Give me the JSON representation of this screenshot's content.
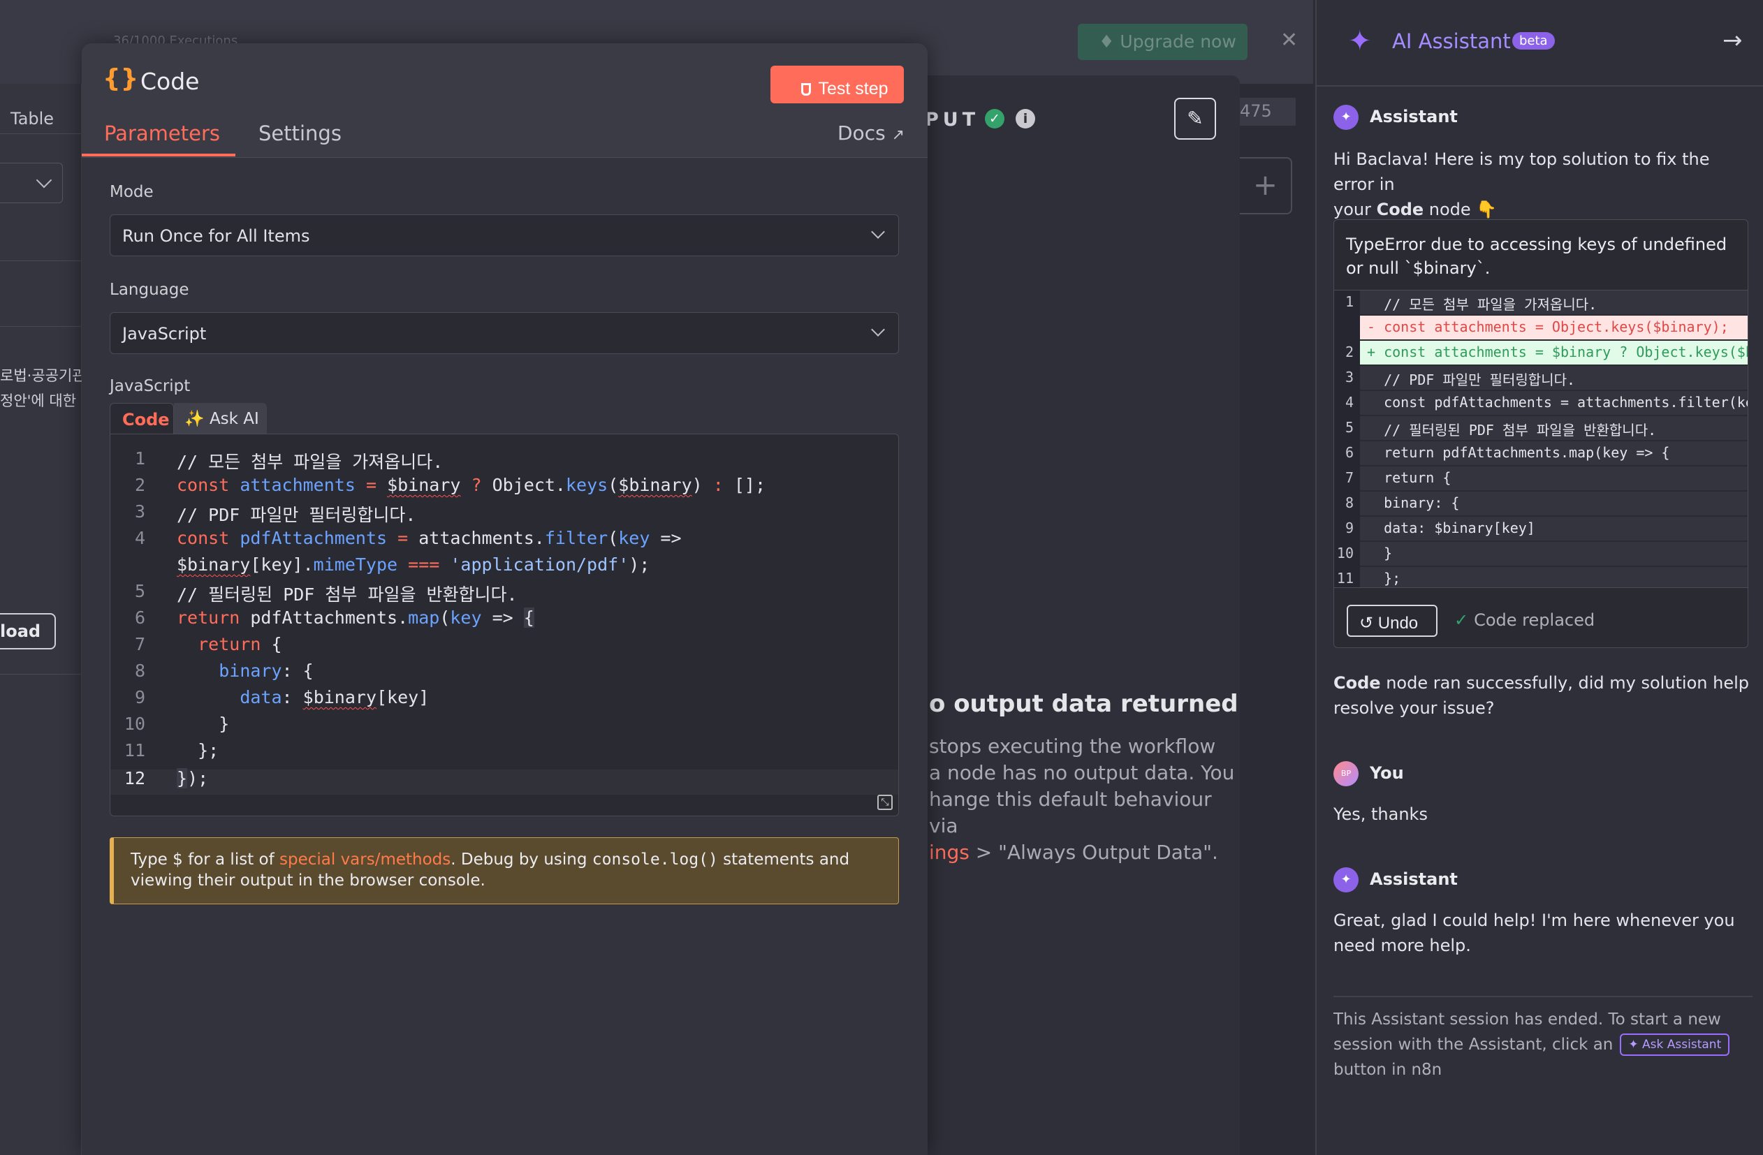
{
  "background": {
    "executions": "36/1000 Executions",
    "left_tab": "Table",
    "korean_1": "로법·공공기관",
    "korean_2": "정안'에 대한",
    "upload_label": "load",
    "upgrade_label": "Upgrade now",
    "close_glyph": "✕",
    "output_title": "PUT",
    "count": "475",
    "no_output_heading": "o output data returned",
    "no_output_desc_1": "stops executing the workflow",
    "no_output_desc_2": "a node has no output data. You",
    "no_output_desc_3": "hange this default behaviour via",
    "no_output_link": "ings",
    "no_output_desc_4": " > \"Always Output Data\"."
  },
  "modal": {
    "icon": "{}",
    "title": "Code",
    "test_step_label": "Test step",
    "tabs": {
      "parameters": "Parameters",
      "settings": "Settings"
    },
    "docs_label": "Docs",
    "mode_label": "Mode",
    "mode_value": "Run Once for All Items",
    "language_label": "Language",
    "language_value": "JavaScript",
    "code_label": "JavaScript",
    "code_tab": "Code",
    "ask_ai_tab": "✨ Ask AI",
    "code_lines": [
      {
        "n": "1",
        "text": "// 모든 첨부 파일을 가져옵니다."
      },
      {
        "n": "2",
        "text": "const attachments = $binary ? Object.keys($binary) : [];"
      },
      {
        "n": "3",
        "text": "// PDF 파일만 필터링합니다."
      },
      {
        "n": "4",
        "text": "const pdfAttachments = attachments.filter(key =>"
      },
      {
        "n": "",
        "text": "$binary[key].mimeType === 'application/pdf');"
      },
      {
        "n": "5",
        "text": "// 필터링된 PDF 첨부 파일을 반환합니다."
      },
      {
        "n": "6",
        "text": "return pdfAttachments.map(key => {"
      },
      {
        "n": "7",
        "text": "return {"
      },
      {
        "n": "8",
        "text": "binary: {"
      },
      {
        "n": "9",
        "text": "data: $binary[key]"
      },
      {
        "n": "10",
        "text": "}"
      },
      {
        "n": "11",
        "text": "};"
      },
      {
        "n": "12",
        "text": "});"
      }
    ],
    "hint": {
      "part1": "Type $ for a list of ",
      "link": "special vars/methods",
      "part2": ". Debug by using ",
      "code": "console.log()",
      "part3": " statements and",
      "part4": "viewing their output in the browser console."
    }
  },
  "assistant": {
    "title": "AI Assistant",
    "beta": "beta",
    "role_assistant": "Assistant",
    "role_you": "You",
    "you_initials": "BP",
    "intro_1": "Hi Baclava! Here is my top solution to fix the error in",
    "intro_2a": "your ",
    "intro_2b": "Code",
    "intro_2c": " node 👇",
    "card_title": "TypeError due to accessing keys of undefined or null `$binary`.",
    "diff_lines": [
      {
        "n": "1",
        "type": "ctx",
        "text": "  // 모든 첨부 파일을 가져옵니다."
      },
      {
        "n": "",
        "type": "del",
        "text": "- const attachments = Object.keys($binary);"
      },
      {
        "n": "2",
        "type": "add",
        "text": "+ const attachments = $binary ? Object.keys($b"
      },
      {
        "n": "3",
        "type": "ctx",
        "text": "  // PDF 파일만 필터링합니다."
      },
      {
        "n": "4",
        "type": "ctx",
        "text": "  const pdfAttachments = attachments.filter(ke"
      },
      {
        "n": "5",
        "type": "ctx",
        "text": "  // 필터링된 PDF 첨부 파일을 반환합니다."
      },
      {
        "n": "6",
        "type": "ctx",
        "text": "  return pdfAttachments.map(key => {"
      },
      {
        "n": "7",
        "type": "ctx",
        "text": "  return {"
      },
      {
        "n": "8",
        "type": "ctx",
        "text": "  binary: {"
      },
      {
        "n": "9",
        "type": "ctx",
        "text": "  data: $binary[key]"
      },
      {
        "n": "10",
        "type": "ctx",
        "text": "  }"
      },
      {
        "n": "11",
        "type": "ctx",
        "text": "  };"
      }
    ],
    "undo_label": "Undo",
    "replaced_label": "Code replaced",
    "followup_b": "Code",
    "followup_rest": " node ran successfully, did my solution help resolve your issue?",
    "you_text": "Yes, thanks",
    "reply": "Great, glad I could help! I'm here whenever you need more help.",
    "ended_1": "This Assistant session has ended. To start a new session with the Assistant, click an",
    "ask_assistant_label": "Ask Assistant",
    "ended_2": "button in n8n"
  }
}
